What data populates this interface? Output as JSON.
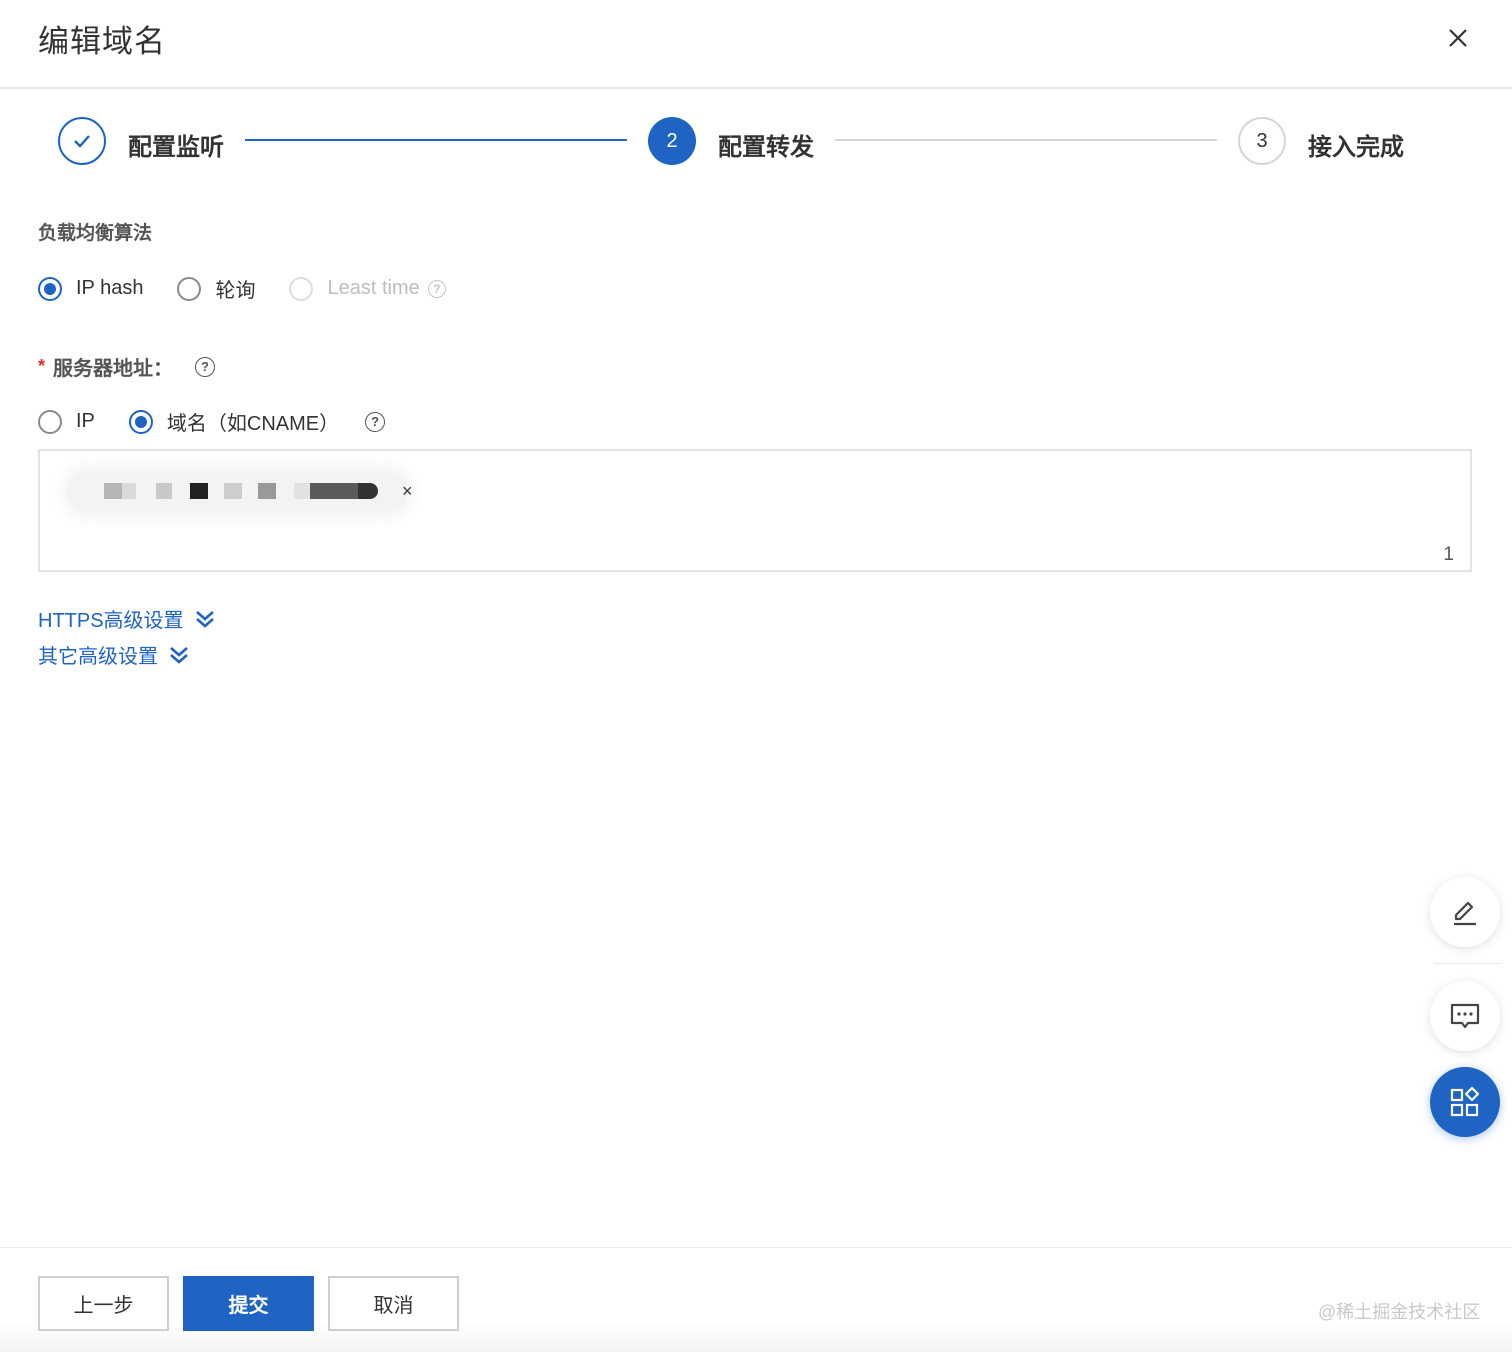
{
  "dialog": {
    "title": "编辑域名"
  },
  "steps": [
    {
      "label": "配置监听",
      "status": "done"
    },
    {
      "label": "配置转发",
      "number": "2",
      "status": "active"
    },
    {
      "label": "接入完成",
      "number": "3",
      "status": "wait"
    }
  ],
  "algorithm": {
    "label": "负载均衡算法",
    "options": [
      {
        "label": "IP hash",
        "selected": true,
        "disabled": false
      },
      {
        "label": "轮询",
        "selected": false,
        "disabled": false
      },
      {
        "label": "Least time",
        "selected": false,
        "disabled": true
      }
    ]
  },
  "server": {
    "required_mark": "*",
    "label": "服务器地址：",
    "options": [
      {
        "label": "IP",
        "selected": false
      },
      {
        "label": "域名（如CNAME）",
        "selected": true
      }
    ],
    "tag_close": "×",
    "count": "1"
  },
  "advanced": {
    "https_label": "HTTPS高级设置",
    "other_label": "其它高级设置"
  },
  "help_glyph": "?",
  "footer": {
    "prev_label": "上一步",
    "submit_label": "提交",
    "cancel_label": "取消",
    "watermark": "@稀土掘金技术社区"
  },
  "colors": {
    "primary": "#1f63c3",
    "required": "#d93026",
    "disabled": "#bdbdbd"
  }
}
